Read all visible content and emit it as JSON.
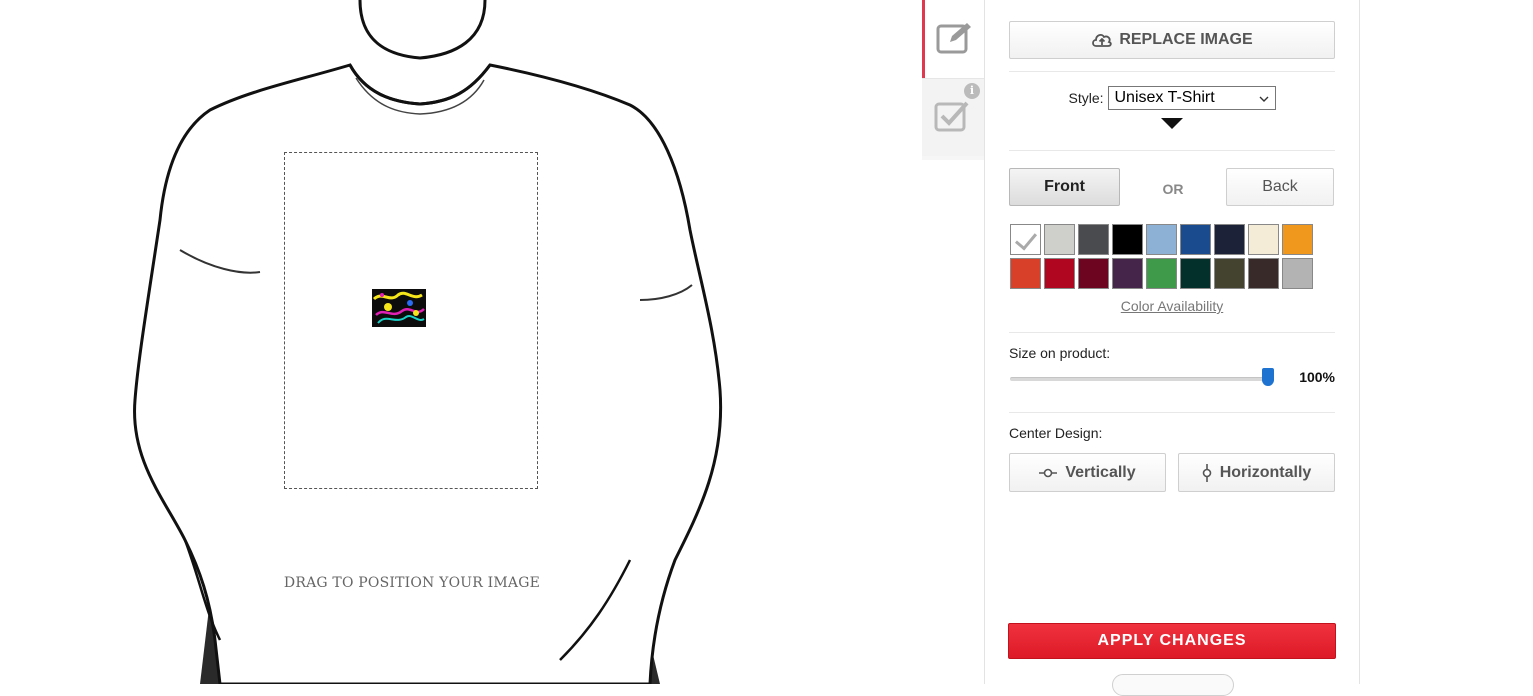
{
  "preview": {
    "drag_hint": "DRAG TO POSITION YOUR IMAGE"
  },
  "side_tabs": {
    "edit_icon": "pencil-square-icon",
    "review_icon": "checkbox-icon",
    "info_badge": "i"
  },
  "panel": {
    "replace_image_label": "REPLACE IMAGE",
    "style_label": "Style:",
    "style_value": "Unisex T-Shirt",
    "front_label": "Front",
    "or_label": "OR",
    "back_label": "Back",
    "colors": [
      {
        "name": "white",
        "hex": "#ffffff",
        "selected": true
      },
      {
        "name": "silver",
        "hex": "#cfd0cb"
      },
      {
        "name": "charcoal",
        "hex": "#4a4b4f"
      },
      {
        "name": "black",
        "hex": "#000000"
      },
      {
        "name": "light-blue",
        "hex": "#8cb1d4"
      },
      {
        "name": "royal-blue",
        "hex": "#1a4b8f"
      },
      {
        "name": "navy",
        "hex": "#1c2238"
      },
      {
        "name": "cream",
        "hex": "#f4ecd6"
      },
      {
        "name": "orange",
        "hex": "#f0971e"
      },
      {
        "name": "red-orange",
        "hex": "#d8402a"
      },
      {
        "name": "red",
        "hex": "#b1061f"
      },
      {
        "name": "maroon",
        "hex": "#6e0520"
      },
      {
        "name": "purple",
        "hex": "#46254a"
      },
      {
        "name": "green",
        "hex": "#3f9b4a"
      },
      {
        "name": "forest",
        "hex": "#03302a"
      },
      {
        "name": "olive",
        "hex": "#43432f"
      },
      {
        "name": "chocolate",
        "hex": "#372a29"
      },
      {
        "name": "heather-grey",
        "hex": "#b3b3b3"
      }
    ],
    "color_availability_link": "Color Availability",
    "size_label": "Size on product:",
    "size_value": "100%",
    "size_percent": 100,
    "center_label": "Center Design:",
    "vertically_label": "Vertically",
    "horizontally_label": "Horizontally",
    "apply_label": "APPLY CHANGES"
  },
  "accent_color": "#e3222e",
  "slider_color": "#1e73d0"
}
